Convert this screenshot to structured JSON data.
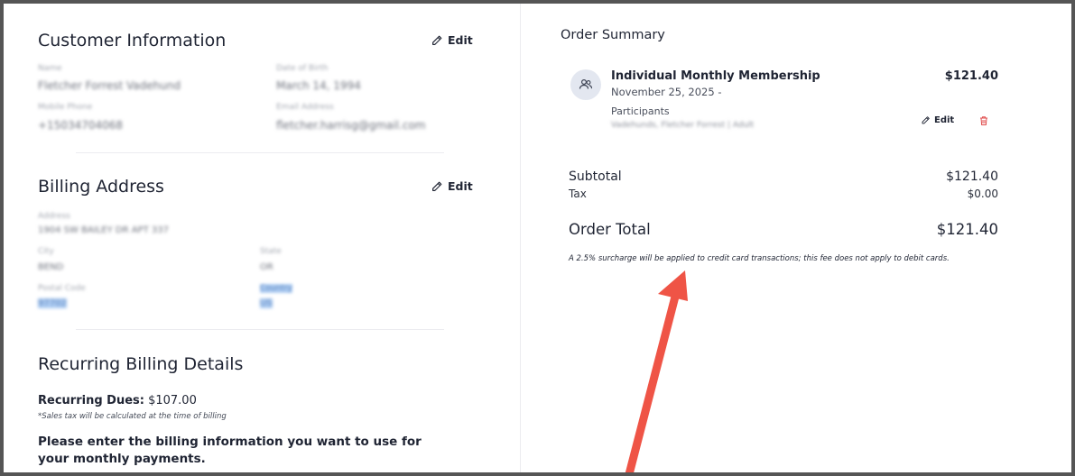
{
  "customer_info": {
    "title": "Customer Information",
    "edit_label": "Edit",
    "fields": {
      "name_label": "Name",
      "name_value": "Fletcher Forrest Vadehund",
      "dob_label": "Date of Birth",
      "dob_value": "March 14, 1994",
      "phone_label": "Mobile Phone",
      "phone_value": "+15034704068",
      "email_label": "Email Address",
      "email_value": "fletcher.harrisg@gmail.com"
    }
  },
  "billing_address": {
    "title": "Billing Address",
    "edit_label": "Edit",
    "fields": {
      "address_label": "Address",
      "address_value": "1904 SW BAILEY DR APT 337",
      "city_label": "City",
      "city_value": "BEND",
      "state_label": "State",
      "state_value": "OR",
      "postal_label": "Postal Code",
      "postal_value": "97702",
      "country_label": "Country",
      "country_value": "US"
    }
  },
  "recurring": {
    "title": "Recurring Billing Details",
    "dues_label": "Recurring Dues:",
    "dues_value": "$107.00",
    "tax_note": "*Sales tax will be calculated at the time of billing",
    "prompt": "Please enter the billing information you want to use for your monthly payments."
  },
  "order_summary": {
    "title": "Order Summary",
    "item": {
      "name": "Individual Monthly Membership",
      "price": "$121.40",
      "date": "November 25, 2025 -",
      "participants_label": "Participants",
      "participants_value": "Vadehunds, Fletcher Forrest | Adult",
      "edit_label": "Edit"
    },
    "subtotal_label": "Subtotal",
    "subtotal_value": "$121.40",
    "tax_label": "Tax",
    "tax_value": "$0.00",
    "total_label": "Order Total",
    "total_value": "$121.40",
    "surcharge_note": "A 2.5% surcharge will be applied to credit card transactions; this fee does not apply to debit cards."
  },
  "colors": {
    "arrow": "#ef5446",
    "trash": "#e04b4b",
    "highlight": "#aecdf3"
  },
  "icons": [
    "pencil-icon",
    "participants-icon",
    "trash-icon",
    "annotation-arrow"
  ]
}
